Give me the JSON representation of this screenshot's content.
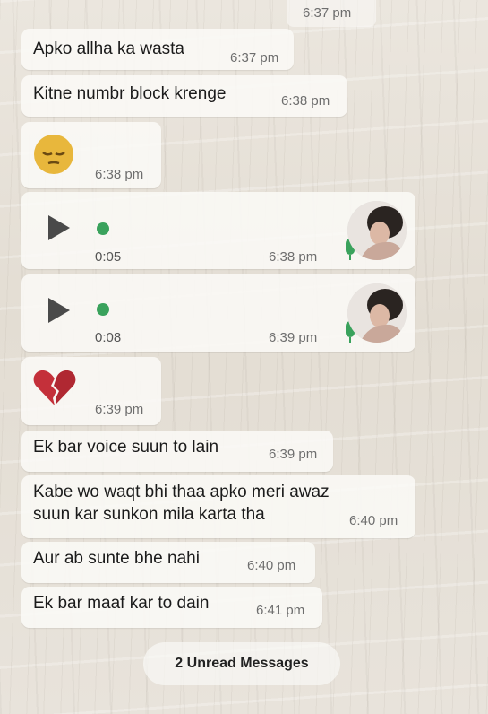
{
  "top_time": "6:37 pm",
  "messages": [
    {
      "text": "Apko allha ka wasta",
      "time": "6:37 pm"
    },
    {
      "text": "Kitne numbr block krenge",
      "time": "6:38 pm"
    },
    {
      "emoji": "pensive-face",
      "time": "6:38 pm"
    },
    {
      "voice_duration": "0:05",
      "time": "6:38 pm"
    },
    {
      "voice_duration": "0:08",
      "time": "6:39 pm"
    },
    {
      "emoji": "broken-heart",
      "time": "6:39 pm"
    },
    {
      "text": "Ek bar voice suun to lain",
      "time": "6:39 pm"
    },
    {
      "text_line1": "Kabe wo waqt bhi thaa apko meri awaz",
      "text_line2": "suun kar sunkon mila karta tha",
      "time": "6:40 pm"
    },
    {
      "text": "Aur ab sunte bhe nahi",
      "time": "6:40 pm"
    },
    {
      "text": "Ek bar maaf kar to dain",
      "time": "6:41 pm"
    }
  ],
  "unread_label": "2 Unread Messages",
  "colors": {
    "bubble": "#faf9f6",
    "voice_dot": "#3aa25c",
    "time": "#6e6e6e"
  }
}
